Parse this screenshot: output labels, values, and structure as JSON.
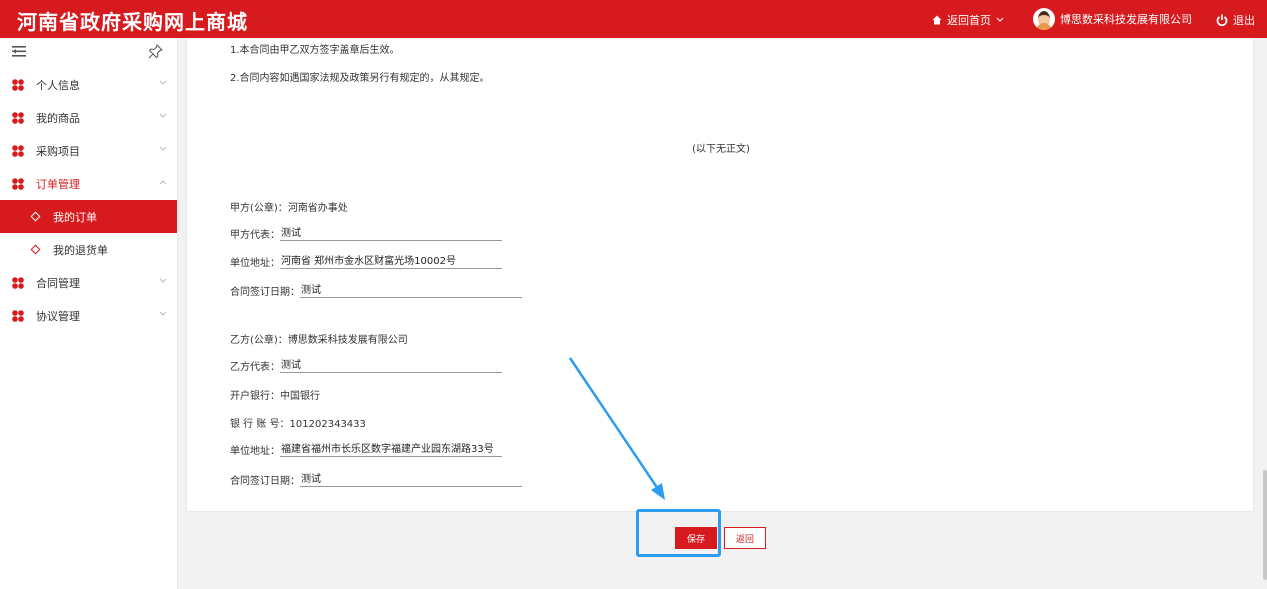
{
  "header": {
    "title": "河南省政府采购网上商城",
    "home_label": "返回首页",
    "company": "博思数采科技发展有限公司",
    "logout_label": "退出"
  },
  "sidebar": {
    "items": [
      {
        "label": "个人信息"
      },
      {
        "label": "我的商品"
      },
      {
        "label": "采购项目"
      },
      {
        "label": "订单管理"
      },
      {
        "label": "合同管理"
      },
      {
        "label": "协议管理"
      }
    ],
    "sub_items": [
      {
        "label": "我的订单"
      },
      {
        "label": "我的退货单"
      }
    ]
  },
  "contract": {
    "clause1": "1.本合同由甲乙双方签字盖章后生效。",
    "clause2": "2.合同内容如遇国家法规及政策另行有规定的，从其规定。",
    "end_note": "(以下无正文)",
    "party_a": {
      "seal_label": "甲方(公章)：",
      "seal_value": "河南省办事处",
      "rep_label": "甲方代表：",
      "rep_value": "测试",
      "addr_label": "单位地址：",
      "addr_value": "河南省 郑州市金水区财富光场10002号",
      "date_label": "合同签订日期：",
      "date_value": "测试"
    },
    "party_b": {
      "seal_label": "乙方(公章)：",
      "seal_value": "博思数采科技发展有限公司",
      "rep_label": "乙方代表：",
      "rep_value": "测试",
      "bank_label": "开户银行：",
      "bank_value": "中国银行",
      "account_label": "银 行 账 号：",
      "account_value": "101202343433",
      "addr_label": "单位地址：",
      "addr_value": "福建省福州市长乐区数字福建产业园东湖路33号",
      "date_label": "合同签订日期：",
      "date_value": "测试"
    }
  },
  "buttons": {
    "save": "保存",
    "back": "返回"
  },
  "colors": {
    "brand": "#d71a1e",
    "annotation": "#2d9bef"
  }
}
